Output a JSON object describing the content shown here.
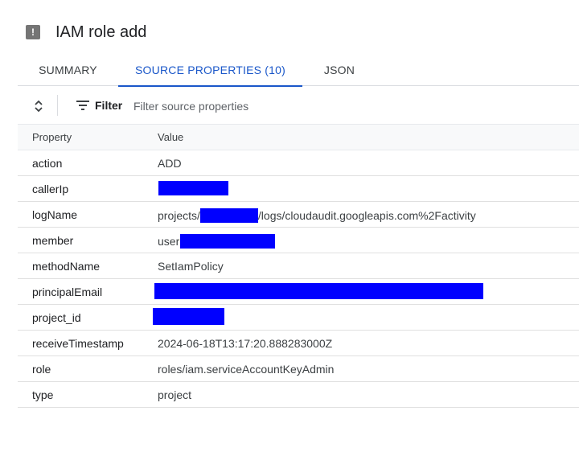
{
  "header": {
    "icon": "warning-icon",
    "icon_glyph": "!",
    "title": "IAM role add"
  },
  "tabs": [
    {
      "label": "SUMMARY",
      "active": false
    },
    {
      "label": "SOURCE PROPERTIES (10)",
      "active": true
    },
    {
      "label": "JSON",
      "active": false
    }
  ],
  "toolbar": {
    "filter_label": "Filter",
    "filter_placeholder": "Filter source properties"
  },
  "table": {
    "headers": [
      "Property",
      "Value"
    ],
    "rows": [
      {
        "property": "action",
        "value": "ADD"
      },
      {
        "property": "callerIp",
        "value": ""
      },
      {
        "property": "logName",
        "value_prefix": "projects/",
        "value_suffix": "/logs/cloudaudit.googleapis.com%2Factivity"
      },
      {
        "property": "member",
        "value_prefix": "user:"
      },
      {
        "property": "methodName",
        "value": "SetIamPolicy"
      },
      {
        "property": "principalEmail",
        "value": ""
      },
      {
        "property": "project_id",
        "value": ""
      },
      {
        "property": "receiveTimestamp",
        "value": "2024-06-18T13:17:20.888283000Z"
      },
      {
        "property": "role",
        "value": "roles/iam.serviceAccountKeyAdmin"
      },
      {
        "property": "type",
        "value": "project"
      }
    ]
  },
  "colors": {
    "accent": "#1a57c9",
    "redaction": "#0000ff"
  }
}
